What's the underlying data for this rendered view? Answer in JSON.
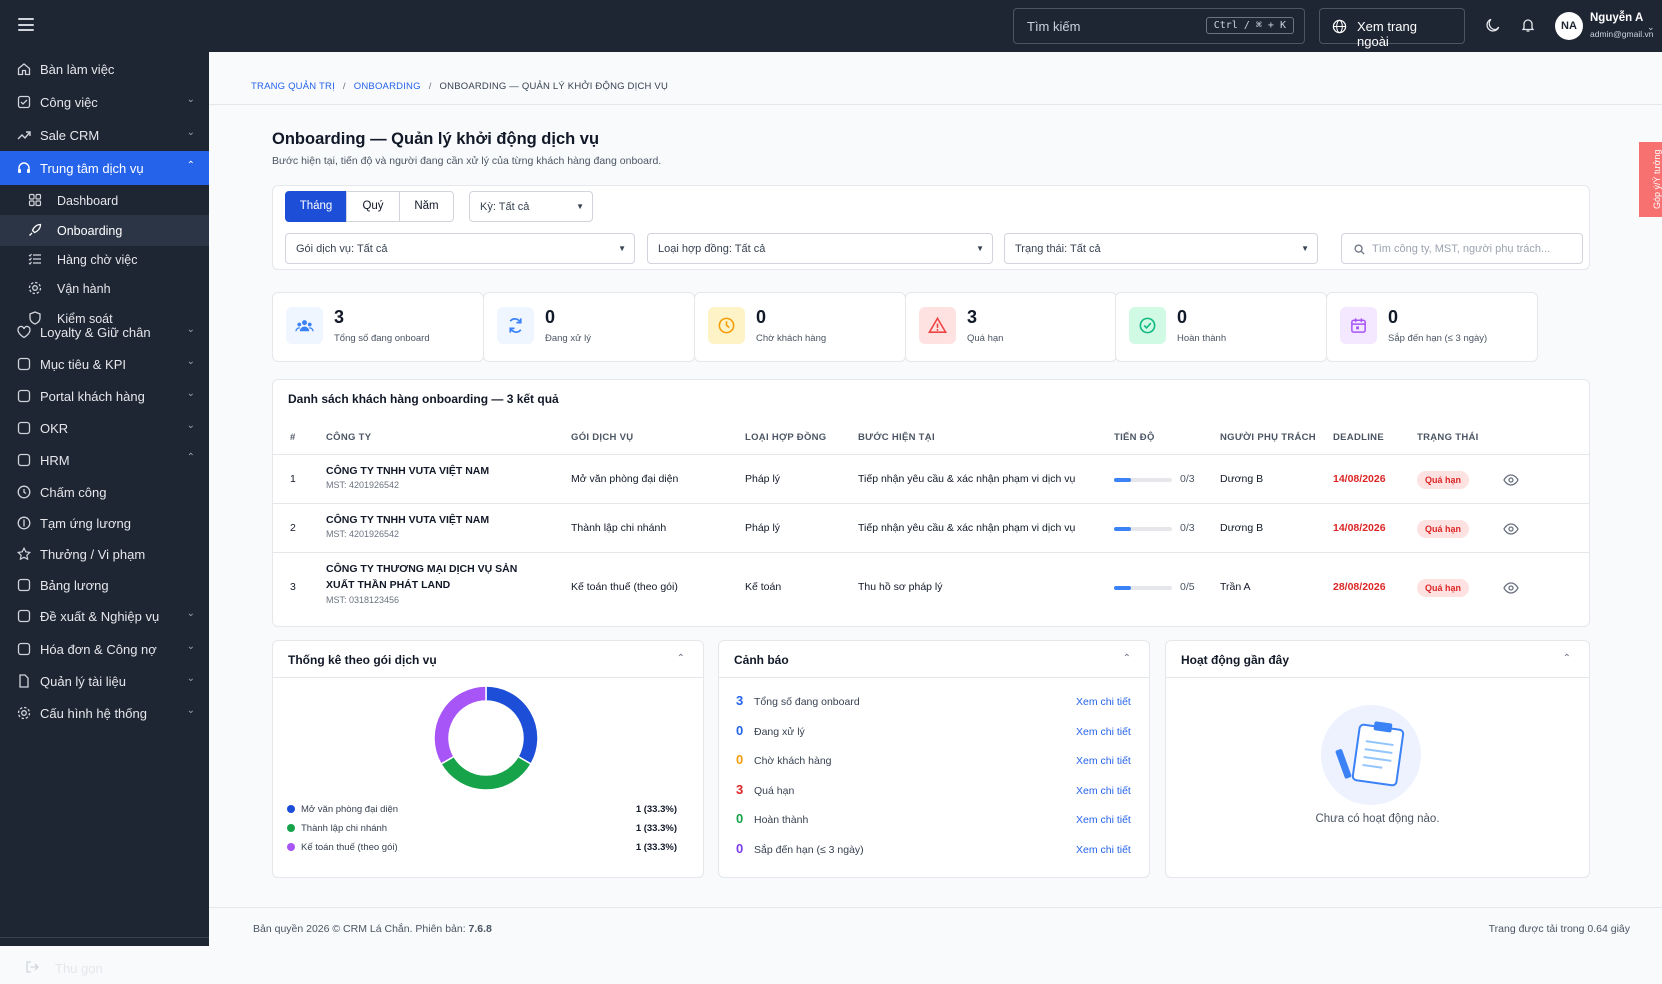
{
  "topbar": {
    "search_placeholder": "Tìm kiếm",
    "search_shortcut": "Ctrl / ⌘ + K",
    "view_site": "Xem trang ngoài",
    "user_initials": "NA",
    "user_name": "Nguyễn A",
    "user_email": "admin@gmail.vn"
  },
  "sidebar": {
    "items": [
      {
        "label": "Bàn làm việc",
        "icon": "home-icon"
      },
      {
        "label": "Công việc",
        "icon": "checkbox-icon"
      },
      {
        "label": "Sale CRM",
        "icon": "trend-icon"
      },
      {
        "label": "Trung tâm dịch vụ",
        "icon": "headset-icon"
      },
      {
        "label": "Loyalty & Giữ chân",
        "icon": "heart-icon"
      },
      {
        "label": "Mục tiêu & KPI",
        "icon": "chart-icon"
      },
      {
        "label": "Portal khách hàng",
        "icon": "portal-icon"
      },
      {
        "label": "OKR",
        "icon": "okr-icon"
      },
      {
        "label": "HRM",
        "icon": "hrm-icon"
      },
      {
        "label": "Chấm công",
        "icon": "clock-icon"
      },
      {
        "label": "Tạm ứng lương",
        "icon": "coin-icon"
      },
      {
        "label": "Thưởng / Vi phạm",
        "icon": "star-icon"
      },
      {
        "label": "Bảng lương",
        "icon": "payroll-icon"
      },
      {
        "label": "Đề xuất & Nghiệp vụ",
        "icon": "proposal-icon"
      },
      {
        "label": "Hóa đơn & Công nợ",
        "icon": "invoice-icon"
      },
      {
        "label": "Quản lý tài liệu",
        "icon": "document-icon"
      },
      {
        "label": "Cấu hình hệ thống",
        "icon": "settings-icon"
      }
    ],
    "subitems": [
      {
        "label": "Dashboard",
        "icon": "grid-icon"
      },
      {
        "label": "Onboarding",
        "icon": "rocket-icon"
      },
      {
        "label": "Hàng chờ việc",
        "icon": "list-icon"
      },
      {
        "label": "Vận hành",
        "icon": "gear-icon"
      },
      {
        "label": "Kiểm soát",
        "icon": "shield-icon"
      }
    ],
    "collapse": "Thu gọn"
  },
  "breadcrumb": [
    "TRANG QUẢN TRỊ",
    "ONBOARDING",
    "ONBOARDING — QUẢN LÝ KHỞI ĐỘNG DỊCH VỤ"
  ],
  "page": {
    "title": "Onboarding — Quản lý khởi động dịch vụ",
    "subtitle": "Bước hiện tại, tiến độ và người đang cần xử lý của từng khách hàng đang onboard.",
    "side_tab": "Góp ý/Ý tưởng"
  },
  "filters": {
    "periods": [
      "Tháng",
      "Quý",
      "Năm"
    ],
    "period": "Kỳ: Tất cả",
    "package": "Gói dịch vụ: Tất cả",
    "contract": "Loại hợp đồng: Tất cả",
    "status": "Trạng thái: Tất cả",
    "search_placeholder": "Tìm công ty, MST, người phụ trách..."
  },
  "stats": [
    {
      "value": "3",
      "label": "Tổng số đang onboard",
      "color": "#3b82f6",
      "bg": "#eff6ff"
    },
    {
      "value": "0",
      "label": "Đang xử lý",
      "color": "#3b82f6",
      "bg": "#eff6ff"
    },
    {
      "value": "0",
      "label": "Chờ khách hàng",
      "color": "#f59e0b",
      "bg": "#fef3c7"
    },
    {
      "value": "3",
      "label": "Quá hạn",
      "color": "#ef4444",
      "bg": "#fee2e2"
    },
    {
      "value": "0",
      "label": "Hoàn thành",
      "color": "#10b981",
      "bg": "#d1fae5"
    },
    {
      "value": "0",
      "label": "Sắp đến hạn (≤ 3 ngày)",
      "color": "#a855f7",
      "bg": "#f3e8ff"
    }
  ],
  "table": {
    "title": "Danh sách khách hàng onboarding — 3 kết quả",
    "headers": [
      "#",
      "CÔNG TY",
      "GÓI DỊCH VỤ",
      "LOẠI HỢP ĐỒNG",
      "BƯỚC HIỆN TẠI",
      "TIẾN ĐỘ",
      "NGƯỜI PHỤ TRÁCH",
      "DEADLINE",
      "TRẠNG THÁI"
    ],
    "rows": [
      {
        "no": "1",
        "company": "CÔNG TY TNHH VUTA VIỆT NAM",
        "mst": "MST: 4201926542",
        "package": "Mở văn phòng đại diện",
        "contract": "Pháp lý",
        "step": "Tiếp nhận yêu cầu & xác nhận phạm vi dịch vụ",
        "progress_text": "0/3",
        "progress": 0.3,
        "owner": "Dương B",
        "deadline": "14/08/2026",
        "status": "Quá hạn"
      },
      {
        "no": "2",
        "company": "CÔNG TY TNHH VUTA VIỆT NAM",
        "mst": "MST: 4201926542",
        "package": "Thành lập chi nhánh",
        "contract": "Pháp lý",
        "step": "Tiếp nhận yêu cầu & xác nhận phạm vi dịch vụ",
        "progress_text": "0/3",
        "progress": 0.3,
        "owner": "Dương B",
        "deadline": "14/08/2026",
        "status": "Quá hạn"
      },
      {
        "no": "3",
        "company": "CÔNG TY THƯƠNG MẠI DỊCH VỤ SẢN XUẤT THẦN PHÁT LAND",
        "mst": "MST: 0318123456",
        "package": "Kế toán thuế (theo gói)",
        "contract": "Kế toán",
        "step": "Thu hồ sơ pháp lý",
        "progress_text": "0/5",
        "progress": 0.3,
        "owner": "Trần A",
        "deadline": "28/08/2026",
        "status": "Quá hạn"
      }
    ]
  },
  "package_stats": {
    "title": "Thống kê theo gói dịch vụ",
    "chart_data": {
      "type": "pie",
      "donut": true,
      "categories": [
        "Mở văn phòng đại diện",
        "Thành lập chi nhánh",
        "Kế toán thuế (theo gói)"
      ],
      "values": [
        1,
        1,
        1
      ],
      "labels": [
        "1 (33.3%)",
        "1 (33.3%)",
        "1 (33.3%)"
      ],
      "colors": [
        "#1d4ed8",
        "#16a34a",
        "#a855f7"
      ]
    }
  },
  "alerts": {
    "title": "Cảnh báo",
    "link": "Xem chi tiết",
    "items": [
      {
        "value": "3",
        "label": "Tổng số đang onboard",
        "color": "#2563eb"
      },
      {
        "value": "0",
        "label": "Đang xử lý",
        "color": "#2563eb"
      },
      {
        "value": "0",
        "label": "Chờ khách hàng",
        "color": "#f59e0b"
      },
      {
        "value": "3",
        "label": "Quá hạn",
        "color": "#dc2626"
      },
      {
        "value": "0",
        "label": "Hoàn thành",
        "color": "#16a34a"
      },
      {
        "value": "0",
        "label": "Sắp đến hạn (≤ 3 ngày)",
        "color": "#7c3aed"
      }
    ]
  },
  "activity": {
    "title": "Hoạt động gần đây",
    "empty": "Chưa có hoạt động nào."
  },
  "footer": {
    "copyright": "Bản quyền 2026 © CRM Lá Chắn. Phiên bản:",
    "version": "7.6.8",
    "load": "Trang được tải trong 0.64 giây"
  }
}
